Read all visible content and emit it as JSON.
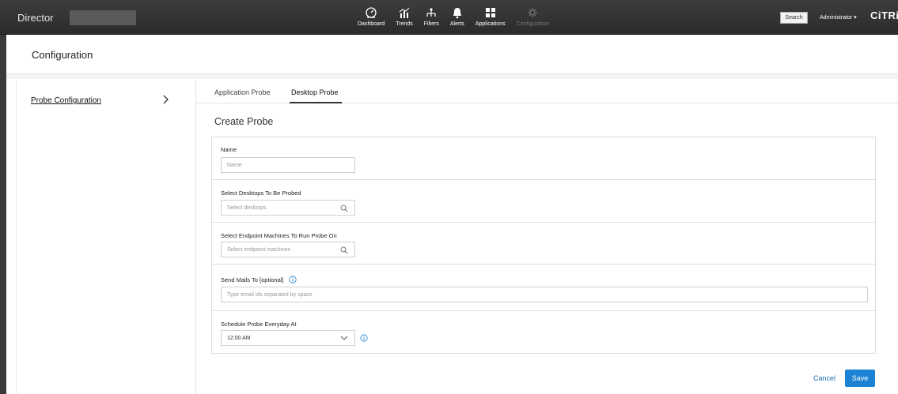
{
  "header": {
    "brand": "Director",
    "nav": [
      {
        "label": "Dashboard",
        "icon": "dashboard-icon"
      },
      {
        "label": "Trends",
        "icon": "trends-icon"
      },
      {
        "label": "Filters",
        "icon": "filters-icon"
      },
      {
        "label": "Alerts",
        "icon": "bell-icon"
      },
      {
        "label": "Applications",
        "icon": "applications-icon"
      },
      {
        "label": "Configuration",
        "icon": "gear-icon"
      }
    ],
    "search_label": "Search",
    "user_menu": "Administrator ▾",
    "logo_text": "CiTRiX"
  },
  "page": {
    "title": "Configuration"
  },
  "sidebar": {
    "items": [
      {
        "label": "Probe Configuration"
      }
    ]
  },
  "tabs": [
    {
      "label": "Application Probe"
    },
    {
      "label": "Desktop Probe"
    }
  ],
  "form": {
    "title": "Create Probe",
    "name": {
      "label": "Name",
      "placeholder": "Name"
    },
    "desktops": {
      "label": "Select Desktops To Be Probed",
      "placeholder": "Select desktops"
    },
    "endpoints": {
      "label": "Select Endpoint Machines To Run Probe On",
      "placeholder": "Select endpoint machines"
    },
    "mails": {
      "label": "Send Mails To [optional]",
      "placeholder": "Type email ids separated by space"
    },
    "schedule": {
      "label": "Schedule Probe Everyday At",
      "value": "12:00 AM"
    }
  },
  "actions": {
    "cancel": "Cancel",
    "save": "Save"
  },
  "colors": {
    "accent": "#1c83d4",
    "header_bg": "#333333",
    "link": "#1c6fb8"
  }
}
